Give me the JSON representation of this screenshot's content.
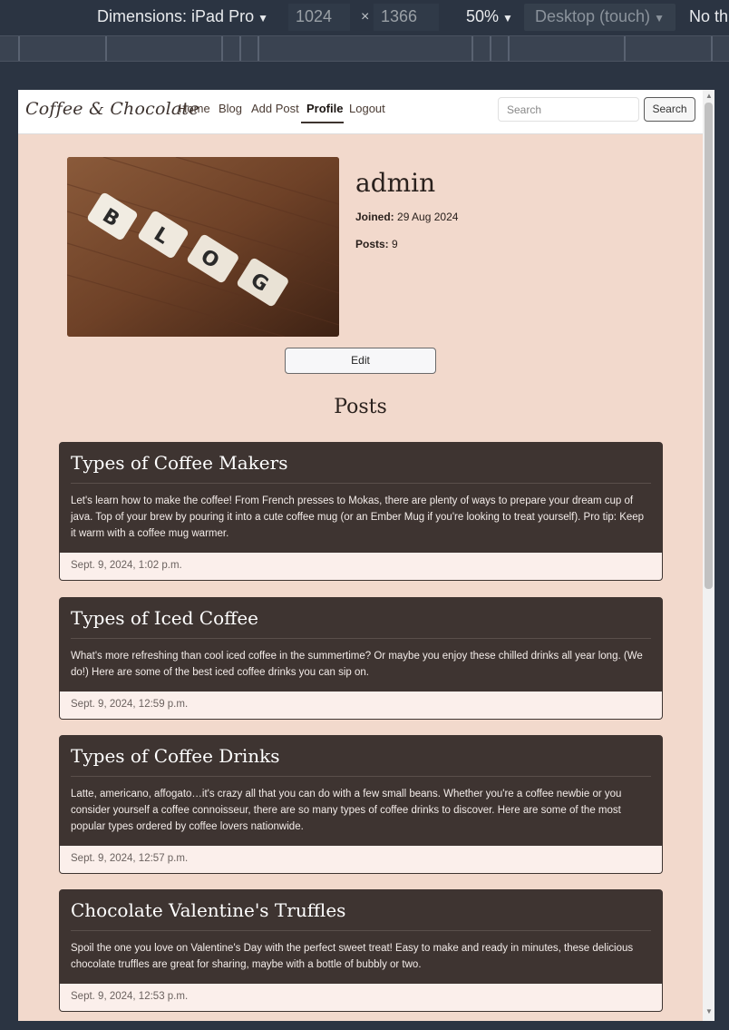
{
  "devtools": {
    "dimensions_label": "Dimensions: iPad Pro",
    "width": "1024",
    "times": "×",
    "height": "1366",
    "zoom": "50%",
    "mode": "Desktop (touch)",
    "throttle": "No th"
  },
  "navbar": {
    "brand": "Coffee & Chocolate",
    "links": [
      "Home",
      "Blog",
      "Add Post",
      "Profile",
      "Logout"
    ],
    "active": "Profile",
    "search_placeholder": "Search",
    "search_button": "Search"
  },
  "profile": {
    "image_alt": "BLOG",
    "username": "admin",
    "joined_label": "Joined:",
    "joined_value": "29 Aug 2024",
    "posts_label": "Posts:",
    "posts_value": "9",
    "edit_button": "Edit"
  },
  "posts_heading": "Posts",
  "posts": [
    {
      "title": "Types of Coffee Makers",
      "excerpt": "Let's learn how to make the coffee! From French presses to Mokas, there are plenty of ways to prepare your dream cup of java. Top of your brew by pouring it into a cute coffee mug (or an Ember Mug if you're looking to treat yourself). Pro tip: Keep it warm with a coffee mug warmer.",
      "date": "Sept. 9, 2024, 1:02 p.m."
    },
    {
      "title": "Types of Iced Coffee",
      "excerpt": "What's more refreshing than cool iced coffee in the summertime? Or maybe you enjoy these chilled drinks all year long. (We do!) Here are some of the best iced coffee drinks you can sip on.",
      "date": "Sept. 9, 2024, 12:59 p.m."
    },
    {
      "title": "Types of Coffee Drinks",
      "excerpt": "Latte, americano, affogato…it's crazy all that you can do with a few small beans. Whether you're a coffee newbie or you consider yourself a coffee connoisseur, there are so many types of coffee drinks to discover. Here are some of the most popular types ordered by coffee lovers nationwide.",
      "date": "Sept. 9, 2024, 12:57 p.m."
    },
    {
      "title": "Chocolate Valentine's Truffles",
      "excerpt": "Spoil the one you love on Valentine's Day with the perfect sweet treat! Easy to make and ready in minutes, these delicious chocolate truffles are great for sharing, maybe with a bottle of bubbly or two.",
      "date": "Sept. 9, 2024, 12:53 p.m."
    }
  ]
}
